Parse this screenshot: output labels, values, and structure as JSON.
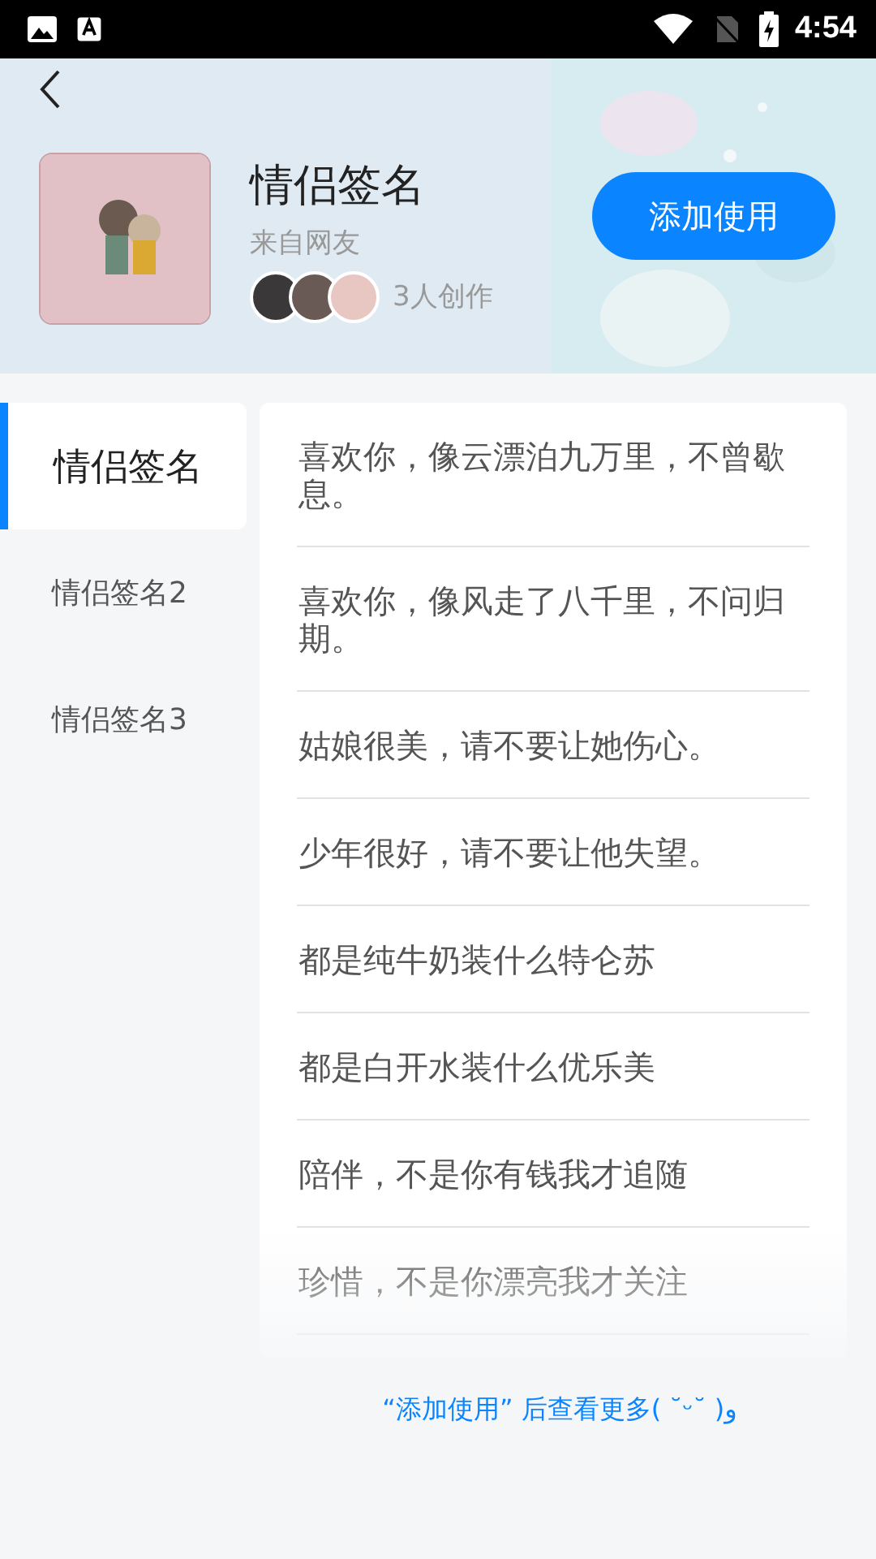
{
  "status_bar": {
    "time": "4:54"
  },
  "header": {
    "title": "情侣签名",
    "source": "来自网友",
    "creators": "3人创作",
    "button": "添加使用"
  },
  "categories": [
    {
      "label": "情侣签名",
      "selected": true
    },
    {
      "label": "情侣签名2",
      "selected": false
    },
    {
      "label": "情侣签名3",
      "selected": false
    }
  ],
  "items": [
    "喜欢你，像云漂泊九万里，不曾歇息。",
    "喜欢你，像风走了八千里，不问归期。",
    "姑娘很美，请不要让她伤心。",
    "少年很好，请不要让他失望。",
    "都是纯牛奶装什么特仑苏",
    "都是白开水装什么优乐美",
    "陪伴，不是你有钱我才追随",
    "珍惜，不是你漂亮我才关注"
  ],
  "footer_hint": "“添加使用” 后查看更多( ˘ᵕ˘ )و"
}
